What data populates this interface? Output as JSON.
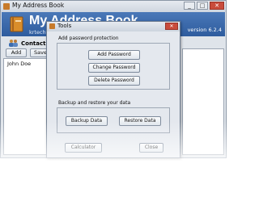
{
  "main_window": {
    "title": "My Address Book",
    "app_name": "My Address Book",
    "app_sub": "krtech...",
    "version": "version 6.2.4",
    "contacts_label": "Contacts",
    "buttons": {
      "add": "Add",
      "save": "Save"
    },
    "contacts": [
      "John  Doe"
    ],
    "window_buttons": {
      "minimize": "_",
      "maximize": "□",
      "close": "✕"
    }
  },
  "dialog": {
    "title": "Tools",
    "close": "✕",
    "password_section": {
      "label": "Add password protection",
      "add": "Add Password",
      "change": "Change Password",
      "delete": "Delete Password"
    },
    "backup_section": {
      "label": "Backup and restore your data",
      "backup": "Backup Data",
      "restore": "Restore Data"
    },
    "calculator": "Calculator",
    "close_button": "Close"
  }
}
